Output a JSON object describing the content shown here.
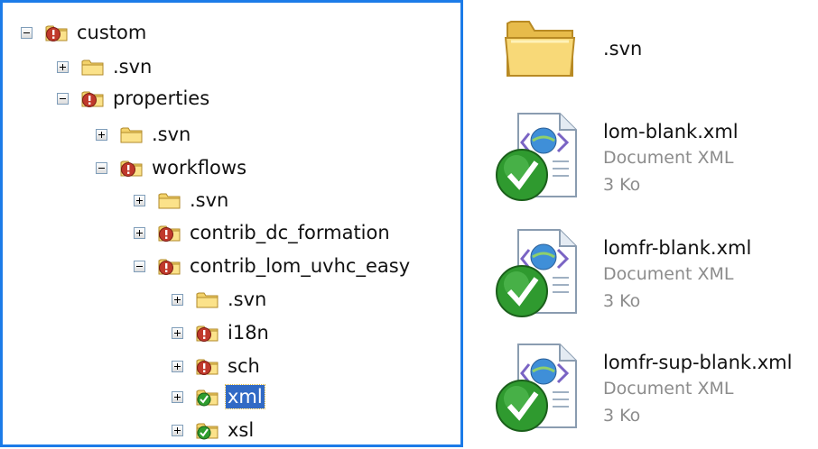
{
  "tree": {
    "nodes": [
      {
        "label": "custom",
        "state": "expanded",
        "status": "conflict"
      },
      {
        "label": ".svn",
        "state": "collapsed",
        "status": "plain"
      },
      {
        "label": "properties",
        "state": "expanded",
        "status": "conflict"
      },
      {
        "label": ".svn",
        "state": "collapsed",
        "status": "plain"
      },
      {
        "label": "workflows",
        "state": "expanded",
        "status": "conflict"
      },
      {
        "label": ".svn",
        "state": "collapsed",
        "status": "plain"
      },
      {
        "label": "contrib_dc_formation",
        "state": "collapsed",
        "status": "conflict"
      },
      {
        "label": "contrib_lom_uvhc_easy",
        "state": "expanded",
        "status": "conflict"
      },
      {
        "label": ".svn",
        "state": "collapsed",
        "status": "plain"
      },
      {
        "label": "i18n",
        "state": "collapsed",
        "status": "conflict"
      },
      {
        "label": "sch",
        "state": "collapsed",
        "status": "conflict"
      },
      {
        "label": "xml",
        "state": "collapsed",
        "status": "normal",
        "selected": true
      },
      {
        "label": "xsl",
        "state": "collapsed",
        "status": "normal"
      }
    ]
  },
  "files": [
    {
      "name": ".svn",
      "kind": "folder-icon"
    },
    {
      "name": "lom-blank.xml",
      "type": "Document XML",
      "size": "3 Ko",
      "kind": "xml-document-icon"
    },
    {
      "name": "lomfr-blank.xml",
      "type": "Document XML",
      "size": "3 Ko",
      "kind": "xml-document-icon"
    },
    {
      "name": "lomfr-sup-blank.xml",
      "type": "Document XML",
      "size": "3 Ko",
      "kind": "xml-document-icon"
    }
  ],
  "colors": {
    "selection": "#316ac5",
    "panel_border": "#1c7be8",
    "conflict_badge": "#c0392b",
    "normal_badge": "#2e9d2e",
    "folder": "#f3d26a",
    "secondary_text": "#8c8c8c"
  }
}
